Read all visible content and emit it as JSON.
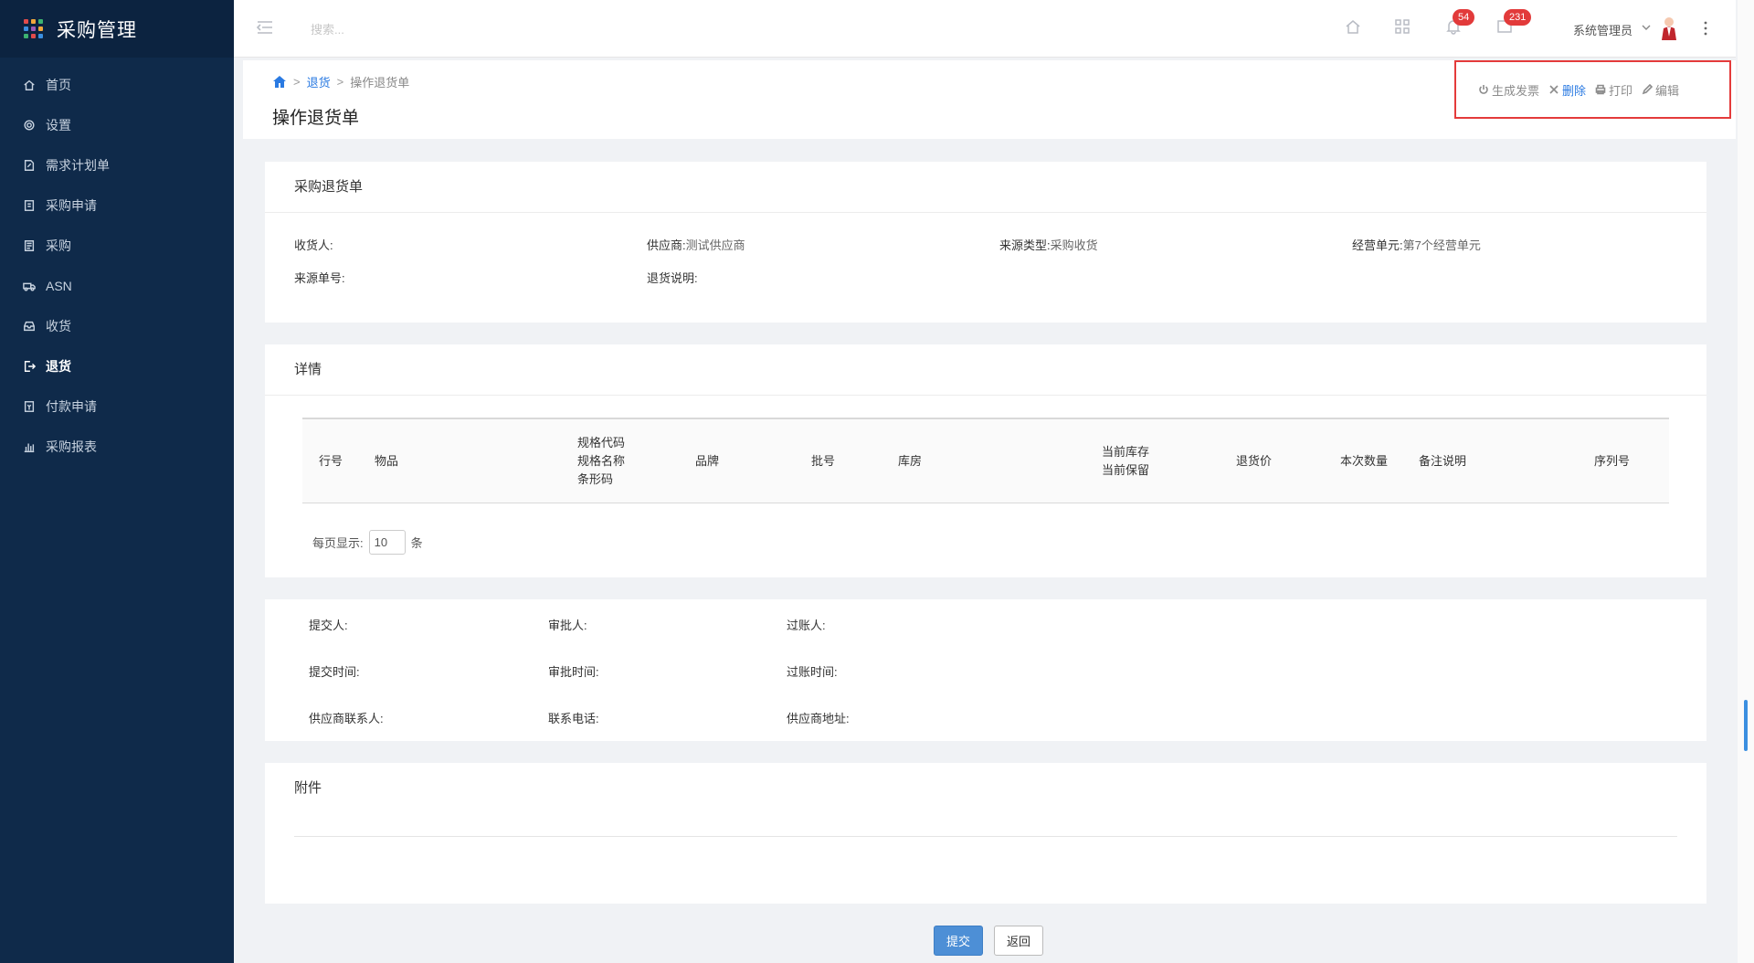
{
  "app": {
    "title": "采购管理",
    "brand_colors": [
      "#e04b4b",
      "#f2a73b",
      "#3cb371",
      "#3b8fe0",
      "#9b59b6",
      "#f2a73b",
      "#3cb371",
      "#e04b4b",
      "#3b8fe0"
    ]
  },
  "sidebar": {
    "items": [
      {
        "label": "首页",
        "icon": "home-icon"
      },
      {
        "label": "设置",
        "icon": "gear-icon"
      },
      {
        "label": "需求计划单",
        "icon": "document-edit-icon"
      },
      {
        "label": "采购申请",
        "icon": "clipboard-icon"
      },
      {
        "label": "采购",
        "icon": "list-icon"
      },
      {
        "label": "ASN",
        "icon": "truck-icon"
      },
      {
        "label": "收货",
        "icon": "inbox-icon"
      },
      {
        "label": "退货",
        "icon": "exit-icon",
        "active": true
      },
      {
        "label": "付款申请",
        "icon": "payment-icon"
      },
      {
        "label": "采购报表",
        "icon": "bar-chart-icon"
      }
    ]
  },
  "topbar": {
    "search_placeholder": "搜索...",
    "notifications_count": "54",
    "messages_count": "231",
    "user_name": "系统管理员"
  },
  "breadcrumb": {
    "level1": "退货",
    "current": "操作退货单"
  },
  "page_title": "操作退货单",
  "actions": {
    "invoice": "生成发票",
    "delete": "删除",
    "print": "打印",
    "edit": "编辑"
  },
  "order_card": {
    "title": "采购退货单",
    "receiver_label": "收货人:",
    "receiver_value": "",
    "supplier_label": "供应商:",
    "supplier_value": "测试供应商",
    "source_type_label": "来源类型:",
    "source_type_value": "采购收货",
    "business_unit_label": "经营单元:",
    "business_unit_value": "第7个经营单元",
    "source_no_label": "来源单号:",
    "source_no_value": "",
    "return_note_label": "退货说明:",
    "return_note_value": ""
  },
  "detail_card": {
    "title": "详情",
    "columns": {
      "line_no": "行号",
      "item": "物品",
      "spec_code": "规格代码",
      "spec_name": "规格名称",
      "barcode": "条形码",
      "brand": "品牌",
      "batch_no": "批号",
      "warehouse": "库房",
      "current_stock": "当前库存",
      "current_reserved": "当前保留",
      "return_price": "退货价",
      "quantity": "本次数量",
      "remark": "备注说明",
      "serial_no": "序列号"
    },
    "page_size_label": "每页显示:",
    "page_size_value": "10",
    "page_size_unit": "条"
  },
  "approval_card": {
    "submitter": "提交人:",
    "approver": "审批人:",
    "poster": "过账人:",
    "submit_time": "提交时间:",
    "approve_time": "审批时间:",
    "post_time": "过账时间:",
    "supplier_contact": "供应商联系人:",
    "phone": "联系电话:",
    "supplier_address": "供应商地址:"
  },
  "attachment_card": {
    "title": "附件"
  },
  "buttons": {
    "submit": "提交",
    "back": "返回"
  }
}
